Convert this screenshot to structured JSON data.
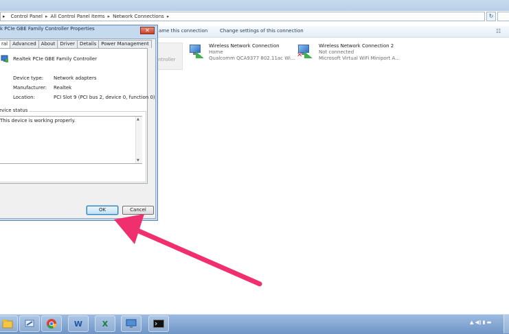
{
  "address_bar": {
    "crumbs": [
      "Control Panel",
      "All Control Panel Items",
      "Network Connections"
    ]
  },
  "command_bar": {
    "rename": "ame this connection",
    "change_settings": "Change settings of this connection"
  },
  "connections": [
    {
      "name": "Wireless Network Connection",
      "line1": "Home",
      "line2": "Qualcomm QCA9377 802.11ac Wi...",
      "connected": true
    },
    {
      "name": "Wireless Network Connection 2",
      "line1": "Not connected",
      "line2": "Microsoft Virtual WiFi Miniport A...",
      "connected": false
    }
  ],
  "ghost_label": "ontroller",
  "dialog": {
    "title": "k PCIe GBE Family Controller Properties",
    "close_glyph": "✕",
    "tabs": [
      "ral",
      "Advanced",
      "About",
      "Driver",
      "Details",
      "Power Management"
    ],
    "device_name": "Realtek PCIe GBE Family Controller",
    "properties": [
      {
        "label": "Device type:",
        "value": "Network adapters"
      },
      {
        "label": "Manufacturer:",
        "value": "Realtek"
      },
      {
        "label": "Location:",
        "value": "PCI Slot 9 (PCI bus 2, device 0, function 0)"
      }
    ],
    "status_legend": "evice status",
    "status_text": "This device is working properly.",
    "ok_label": "OK",
    "cancel_label": "Cancel"
  },
  "taskbar": {
    "apps": [
      "folder",
      "network-tool",
      "chrome",
      "word",
      "excel",
      "remote-desktop",
      "command-prompt"
    ],
    "word_glyph": "W",
    "excel_glyph": "X",
    "tray_text": "▲ ◀ǁ ▮ ▬"
  },
  "colors": {
    "arrow": "#f0306e",
    "taskbar": "#7fa3d1",
    "dialog_frame": "#c5d9ef"
  }
}
